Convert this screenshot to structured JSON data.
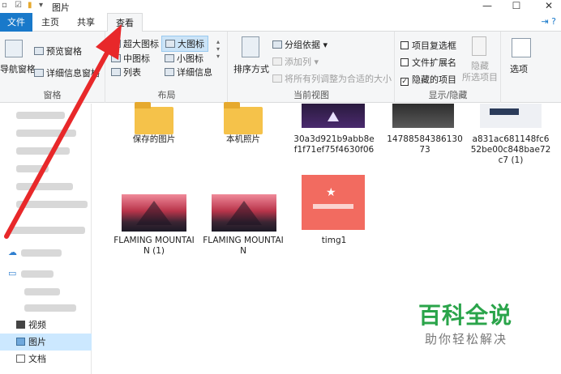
{
  "window": {
    "title": "图片",
    "controls": {
      "minimize": "—",
      "maximize": "☐",
      "close": "✕"
    }
  },
  "tabs": [
    {
      "label": "文件"
    },
    {
      "label": "主页"
    },
    {
      "label": "共享"
    },
    {
      "label": "查看"
    }
  ],
  "ribbon": {
    "panes": {
      "label": "窗格",
      "nav_pane": "导航窗格",
      "preview_pane": "预览窗格",
      "details_pane": "详细信息窗格"
    },
    "layout": {
      "label": "布局",
      "extra_large_icons": "超大图标",
      "large_icons": "大图标",
      "medium_icons": "中图标",
      "small_icons": "小图标",
      "list": "列表",
      "details": "详细信息"
    },
    "current_view": {
      "label": "当前视图",
      "sort_by": "排序方式",
      "group_by": "分组依据",
      "add_columns": "添加列",
      "size_all_columns": "将所有列调整为合适的大小"
    },
    "show_hide": {
      "label": "显示/隐藏",
      "item_checkboxes": "项目复选框",
      "file_extensions": "文件扩展名",
      "hidden_items": "隐藏的项目",
      "hide_selected": "隐藏\n所选项目",
      "hide_selected_l1": "隐藏",
      "hide_selected_l2": "所选项目"
    },
    "options": {
      "label": "选项"
    }
  },
  "nav": {
    "items": [
      {
        "label": "视频"
      },
      {
        "label": "图片"
      },
      {
        "label": "文档"
      }
    ]
  },
  "files": [
    {
      "name": "保存的图片",
      "type": "folder"
    },
    {
      "name": "本机照片",
      "type": "folder"
    },
    {
      "name": "30a3d921b9abb8ef1f71ef75f4630f06",
      "type": "image"
    },
    {
      "name": "1478858438613073",
      "type": "image"
    },
    {
      "name": "a831ac681148fc652be00c848bae72c7 (1)",
      "type": "image"
    },
    {
      "name": "FLAMING MOUNTAIN (1)",
      "type": "image"
    },
    {
      "name": "FLAMING MOUNTAIN",
      "type": "image"
    },
    {
      "name": "timg1",
      "type": "image"
    }
  ],
  "watermark": {
    "brand": "百科全说",
    "slogan": "助你轻松解决"
  },
  "colors": {
    "file_tab": "#1979ca",
    "arrow": "#e8282a",
    "watermark": "#2aa44a",
    "selection": "#cce8ff"
  }
}
